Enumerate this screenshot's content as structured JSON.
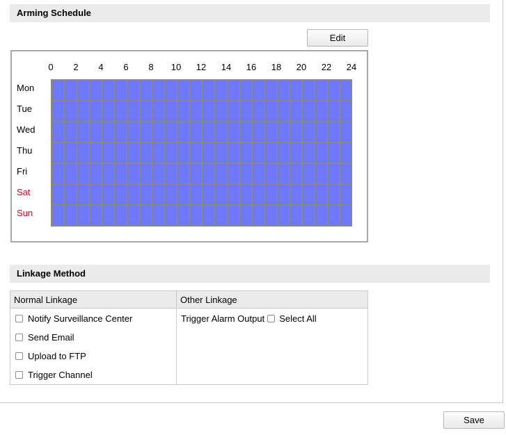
{
  "arming_schedule": {
    "title": "Arming Schedule",
    "edit_label": "Edit",
    "hour_labels": [
      "0",
      "2",
      "4",
      "6",
      "8",
      "10",
      "12",
      "14",
      "16",
      "18",
      "20",
      "22",
      "24"
    ],
    "days": [
      {
        "label": "Mon",
        "weekend": false
      },
      {
        "label": "Tue",
        "weekend": false
      },
      {
        "label": "Wed",
        "weekend": false
      },
      {
        "label": "Thu",
        "weekend": false
      },
      {
        "label": "Fri",
        "weekend": false
      },
      {
        "label": "Sat",
        "weekend": true
      },
      {
        "label": "Sun",
        "weekend": true
      }
    ],
    "armed_fraction": 1.0,
    "armed_color": "#6e78f8",
    "weekend_color": "#e8001c"
  },
  "linkage_method": {
    "title": "Linkage Method",
    "normal_header": "Normal Linkage",
    "other_header": "Other Linkage",
    "normal_options": [
      {
        "label": "Notify Surveillance Center",
        "checked": false
      },
      {
        "label": "Send Email",
        "checked": false
      },
      {
        "label": "Upload to FTP",
        "checked": false
      },
      {
        "label": "Trigger Channel",
        "checked": false
      }
    ],
    "trigger_alarm_label": "Trigger Alarm Output",
    "select_all_label": "Select All",
    "select_all_checked": false
  },
  "footer": {
    "save_label": "Save"
  }
}
